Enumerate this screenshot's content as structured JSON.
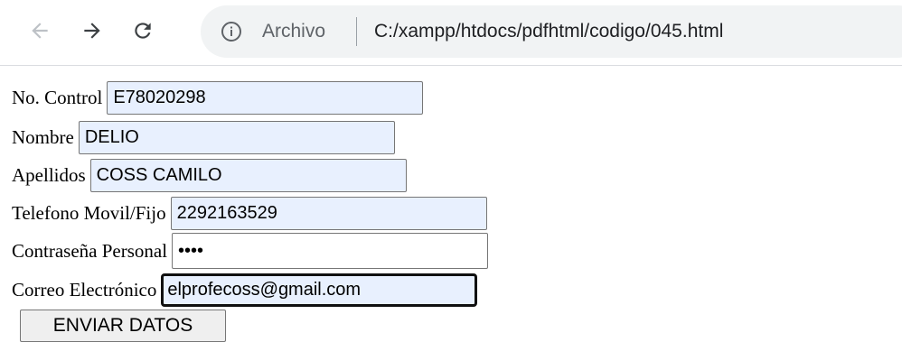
{
  "browser": {
    "nav": {
      "back_icon": "arrow-left-icon",
      "forward_icon": "arrow-right-icon",
      "reload_icon": "reload-icon"
    },
    "address_bar": {
      "info_icon": "info-icon",
      "scheme_label": "Archivo",
      "url": "C:/xampp/htdocs/pdfhtml/codigo/045.html"
    }
  },
  "form": {
    "fields": [
      {
        "label": "No. Control",
        "value": "E78020298"
      },
      {
        "label": "Nombre",
        "value": "DELIO"
      },
      {
        "label": "Apellidos",
        "value": "COSS CAMILO"
      },
      {
        "label": "Telefono Movil/Fijo",
        "value": "2292163529"
      },
      {
        "label": "Contraseña Personal",
        "value": "abcd",
        "type": "password"
      },
      {
        "label": "Correo Electrónico",
        "value": "elprofecoss@gmail.com"
      }
    ],
    "submit_label": "ENVIAR DATOS"
  },
  "colors": {
    "autofill_background": "#e8f0fe",
    "omnibox_background": "#f1f3f4",
    "button_background": "#efefef"
  }
}
